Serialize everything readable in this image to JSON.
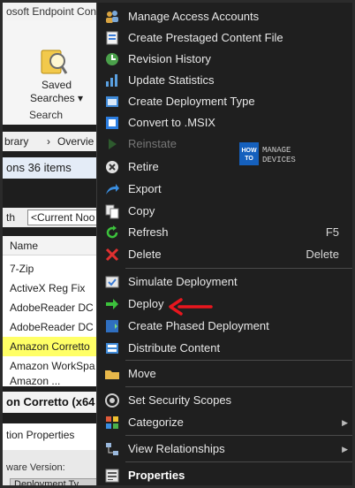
{
  "app": {
    "title": "osoft Endpoint Con",
    "ribbon": {
      "saved_searches_line1": "Saved",
      "saved_searches_line2": "Searches ▾",
      "group_label": "Search"
    },
    "breadcrumb": [
      "brary",
      "›",
      "Overvie"
    ],
    "count_text": "ons 36 items",
    "filter": {
      "label": "th",
      "value": "<Current Noo"
    },
    "list": {
      "header": "Name",
      "rows": [
        "7-Zip",
        "ActiveX Reg Fix",
        "AdobeReader DC",
        "AdobeReader DC",
        "Amazon Corretto",
        "Amazon WorkSpa",
        "Amazon ..."
      ],
      "selected_index": 4
    },
    "details_title": "on Corretto (x64",
    "details_props": "tion Properties",
    "bottom": {
      "line1": "ware Version:",
      "tab": "Deployment Ty"
    }
  },
  "context_menu": {
    "items": [
      {
        "label": "Manage Access Accounts",
        "icon": "key-people-icon"
      },
      {
        "label": "Create Prestaged Content File",
        "icon": "prestaged-file-icon"
      },
      {
        "label": "Revision History",
        "icon": "revision-history-icon"
      },
      {
        "label": "Update Statistics",
        "icon": "statistics-icon"
      },
      {
        "label": "Create Deployment Type",
        "icon": "deployment-type-icon"
      },
      {
        "label": "Convert to .MSIX",
        "icon": "msix-icon"
      },
      {
        "label": "Reinstate",
        "icon": "play-icon",
        "disabled": true
      },
      {
        "label": "Retire",
        "icon": "retire-icon"
      },
      {
        "label": "Export",
        "icon": "export-icon"
      },
      {
        "label": "Copy",
        "icon": "copy-icon"
      },
      {
        "label": "Refresh",
        "icon": "refresh-icon",
        "shortcut": "F5"
      },
      {
        "label": "Delete",
        "icon": "delete-icon",
        "shortcut": "Delete"
      },
      {
        "label": "Simulate Deployment",
        "icon": "simulate-icon"
      },
      {
        "label": "Deploy",
        "icon": "deploy-arrow-icon"
      },
      {
        "label": "Create Phased Deployment",
        "icon": "phased-deployment-icon"
      },
      {
        "label": "Distribute Content",
        "icon": "distribute-content-icon"
      },
      {
        "label": "Move",
        "icon": "folder-move-icon"
      },
      {
        "label": "Set Security Scopes",
        "icon": "security-scopes-icon"
      },
      {
        "label": "Categorize",
        "icon": "categorize-icon",
        "submenu": true
      },
      {
        "label": "View Relationships",
        "icon": "relationships-icon",
        "submenu": true
      },
      {
        "label": "Properties",
        "icon": "properties-icon",
        "bold": true
      }
    ]
  },
  "watermark": {
    "how": "HOW",
    "to": "TO",
    "manage": "MANAGE",
    "devices": "DEVICES"
  },
  "colors": {
    "menu_bg": "#1f1f1f",
    "selected_row": "#ffff66",
    "annotation_arrow": "#e8161e",
    "deploy_green": "#3cc23c"
  }
}
